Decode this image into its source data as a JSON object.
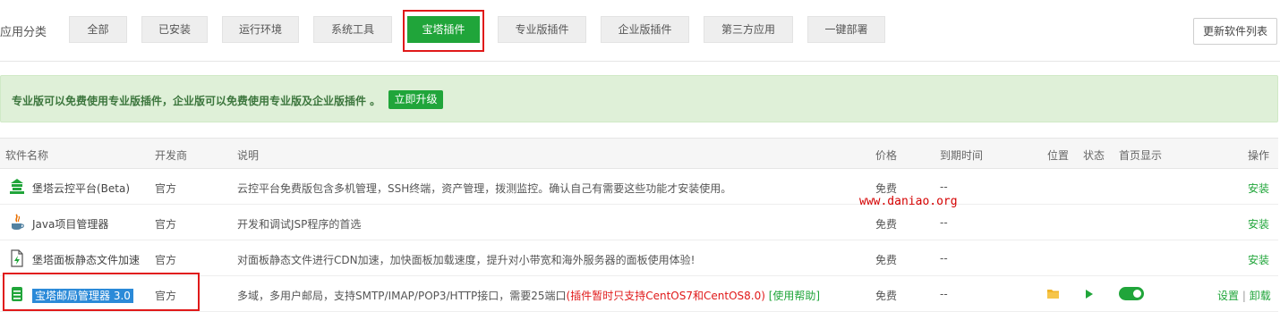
{
  "category": {
    "label": "应用分类",
    "tabs": [
      "全部",
      "已安装",
      "运行环境",
      "系统工具",
      "宝塔插件",
      "专业版插件",
      "企业版插件",
      "第三方应用",
      "一键部署"
    ],
    "active_index": 4,
    "refresh_label": "更新软件列表"
  },
  "notice": {
    "text": "专业版可以免费使用专业版插件，企业版可以免费使用专业版及企业版插件 。",
    "upgrade_label": "立即升级"
  },
  "table": {
    "headers": {
      "name": "软件名称",
      "developer": "开发商",
      "desc": "说明",
      "price": "价格",
      "expire": "到期时间",
      "location": "位置",
      "status": "状态",
      "homepage": "首页显示",
      "actions": "操作"
    },
    "rows": [
      {
        "name": "堡塔云控平台(Beta)",
        "developer": "官方",
        "desc": "云控平台免费版包含多机管理，SSH终端，资产管理，拨测监控。确认自己有需要这些功能才安装使用。",
        "price": "免费",
        "expire": "--",
        "action": "安装",
        "icon": "cloud-control-icon"
      },
      {
        "name": "Java项目管理器",
        "developer": "官方",
        "desc": "开发和调试JSP程序的首选",
        "price": "免费",
        "expire": "--",
        "action": "安装",
        "icon": "java-icon"
      },
      {
        "name": "堡塔面板静态文件加速",
        "developer": "官方",
        "desc": "对面板静态文件进行CDN加速，加快面板加载速度，提升对小带宽和海外服务器的面板使用体验!",
        "price": "免费",
        "expire": "--",
        "action": "安装",
        "icon": "file-icon"
      },
      {
        "name": "宝塔邮局管理器 3.0",
        "developer": "官方",
        "desc": "多域，多用户邮局，支持SMTP/IMAP/POP3/HTTP接口，需要25端口",
        "desc_warn": "(插件暂时只支持CentOS7和CentOS8.0)",
        "desc_help": "[使用帮助]",
        "price": "免费",
        "expire": "--",
        "action_settings": "设置",
        "action_sep": "|",
        "action_uninstall": "卸载",
        "icon": "mail-server-icon",
        "homepage_shown": true
      }
    ]
  },
  "watermark": "www.daniao.org",
  "colors": {
    "accent": "#20a53a",
    "highlight": "#e01919",
    "notice_bg": "#dff0d8",
    "selection": "#2b8ad8"
  }
}
